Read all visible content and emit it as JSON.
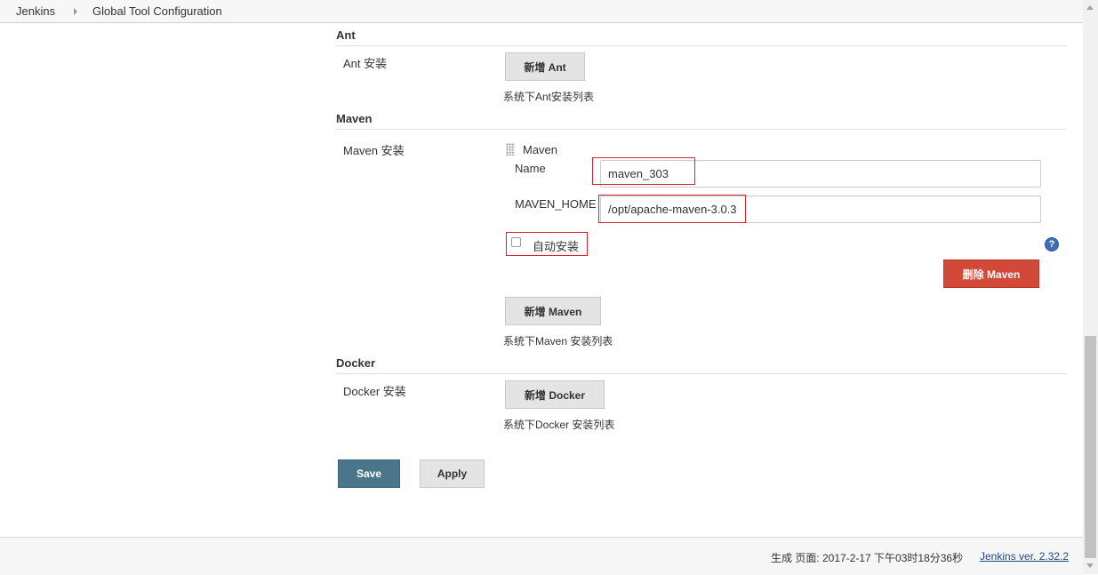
{
  "breadcrumb": {
    "items": [
      "Jenkins",
      "Global Tool Configuration"
    ]
  },
  "ant": {
    "section_title": "Ant",
    "install_label": "Ant 安装",
    "add_button": "新增 Ant",
    "hint": "系统下Ant安装列表"
  },
  "maven": {
    "section_title": "Maven",
    "install_label": "Maven 安装",
    "installation_heading": "Maven",
    "name_label": "Name",
    "name_value": "maven_303",
    "home_label": "MAVEN_HOME",
    "home_value": "/opt/apache-maven-3.0.3",
    "auto_install_label": "自动安装",
    "auto_install_checked": false,
    "help_icon": "?",
    "delete_button": "删除 Maven",
    "add_button": "新增 Maven",
    "hint": "系统下Maven 安装列表"
  },
  "docker": {
    "section_title": "Docker",
    "install_label": "Docker 安装",
    "add_button": "新增 Docker",
    "hint": "系统下Docker 安装列表"
  },
  "actions": {
    "save": "Save",
    "apply": "Apply"
  },
  "footer": {
    "generated": "生成 页面: 2017-2-17 下午03时18分36秒",
    "version_link": "Jenkins ver. 2.32.2"
  },
  "colors": {
    "save_button": "#4b758b",
    "delete_button": "#d24939",
    "highlight_box": "#d9232b",
    "link": "#204a87"
  }
}
